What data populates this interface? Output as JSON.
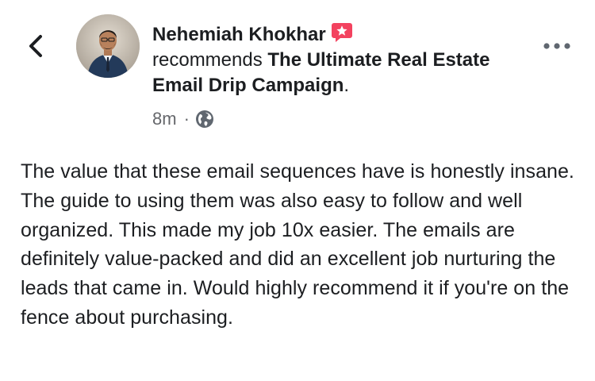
{
  "post": {
    "author": "Nehemiah Khokhar",
    "action": "recommends",
    "page": "The Ultimate Real Estate Email Drip Campaign",
    "page_suffix": ".",
    "time": "8m",
    "separator": "·",
    "privacy_icon": "globe-icon",
    "badge_icon": "recommendation-star-icon",
    "body": "The value that these email sequences have is honestly insane. The guide to using them was also easy to follow and well organized. This made my job 10x easier. The emails are definitely value-packed and did an excellent job nurturing the leads that came in. Would highly recommend it if you're on the fence about purchasing."
  },
  "nav": {
    "back_icon": "chevron-left-icon",
    "more_icon": "more-horizontal-icon"
  },
  "colors": {
    "text": "#1c1e21",
    "meta": "#65676b",
    "badge": "#f3425f",
    "icon_gray": "#606770"
  }
}
